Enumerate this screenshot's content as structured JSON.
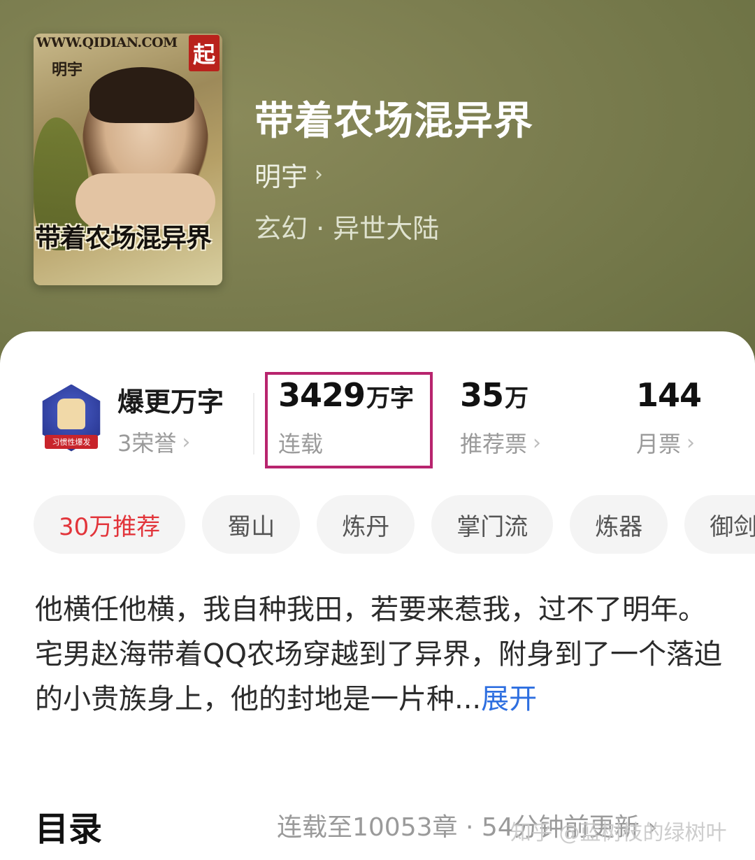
{
  "cover": {
    "site": "WWW.QIDIAN.COM",
    "logo": "起",
    "author": "明宇",
    "title": "带着农场混异界"
  },
  "book": {
    "title": "带着农场混异界",
    "author": "明宇",
    "genre": "玄幻 · 异世大陆"
  },
  "honor": {
    "badge_text": "习惯性爆发",
    "title": "爆更万字",
    "sub": "3荣誉"
  },
  "stats": {
    "words_num": "3429",
    "words_unit": "万字",
    "words_label": "连载",
    "rec_num": "35",
    "rec_unit": "万",
    "rec_label": "推荐票",
    "month_num": "144",
    "month_label": "月票"
  },
  "tags": [
    "30万推荐",
    "蜀山",
    "炼丹",
    "掌门流",
    "炼器",
    "御剑"
  ],
  "description": {
    "line1": "他横任他横，我自种我田，若要来惹我，过不了明年。",
    "line2": "宅男赵海带着QQ农场穿越到了异界，附身到了一个落迫的小贵族身上，他的封地是一片种...",
    "expand": "展开"
  },
  "catalog": {
    "title": "目录",
    "info": "连载至10053章 · 54分钟前更新 ›"
  },
  "watermark": "知乎 @蓝树枝的绿树叶"
}
